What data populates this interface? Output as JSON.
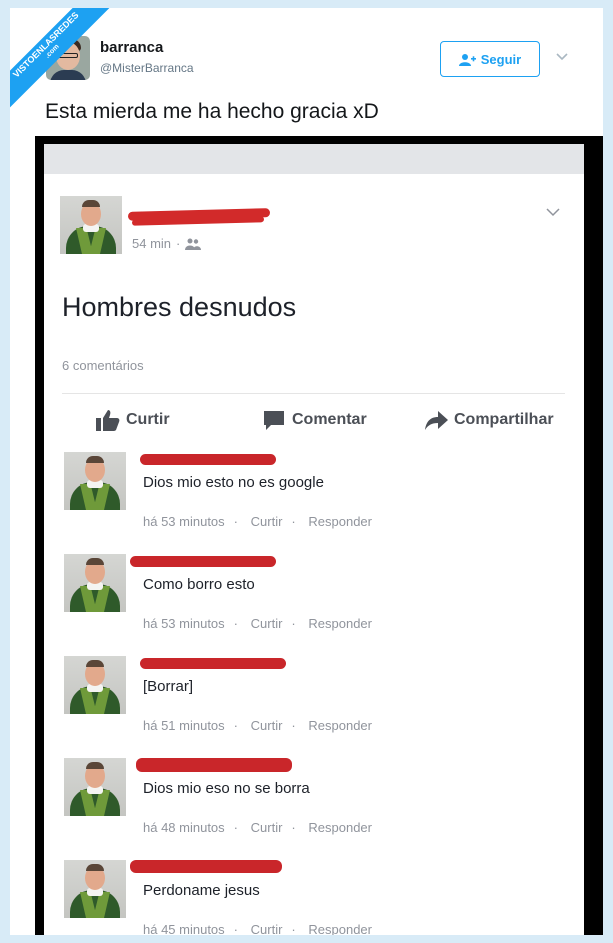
{
  "watermark": {
    "line1": "VISTOENLASREDES",
    "line2": ".com"
  },
  "tweet": {
    "author_name": "barranca",
    "author_handle": "@MisterBarranca",
    "follow_label": "Seguir",
    "text": "Esta mierda me ha hecho gracia xD"
  },
  "post": {
    "time": "54 min",
    "title": "Hombres desnudos",
    "comments_count": "6 comentários",
    "actions": {
      "like": "Curtir",
      "comment": "Comentar",
      "share": "Compartilhar"
    }
  },
  "comments": [
    {
      "text": "Dios mio esto no es google",
      "time": "há 53 minutos",
      "like": "Curtir",
      "reply": "Responder"
    },
    {
      "text": "Como borro esto",
      "time": "há 53 minutos",
      "like": "Curtir",
      "reply": "Responder"
    },
    {
      "text": "[Borrar]",
      "time": "há 51 minutos",
      "like": "Curtir",
      "reply": "Responder"
    },
    {
      "text": "Dios mio eso no se borra",
      "time": "há 48 minutos",
      "like": "Curtir",
      "reply": "Responder"
    },
    {
      "text": "Perdoname jesus",
      "time": "há 45 minutos",
      "like": "Curtir",
      "reply": "Responder"
    }
  ],
  "colors": {
    "twitter_blue": "#1da1f2",
    "redaction_red": "#d22a2a",
    "meta_gray": "#90949c"
  }
}
